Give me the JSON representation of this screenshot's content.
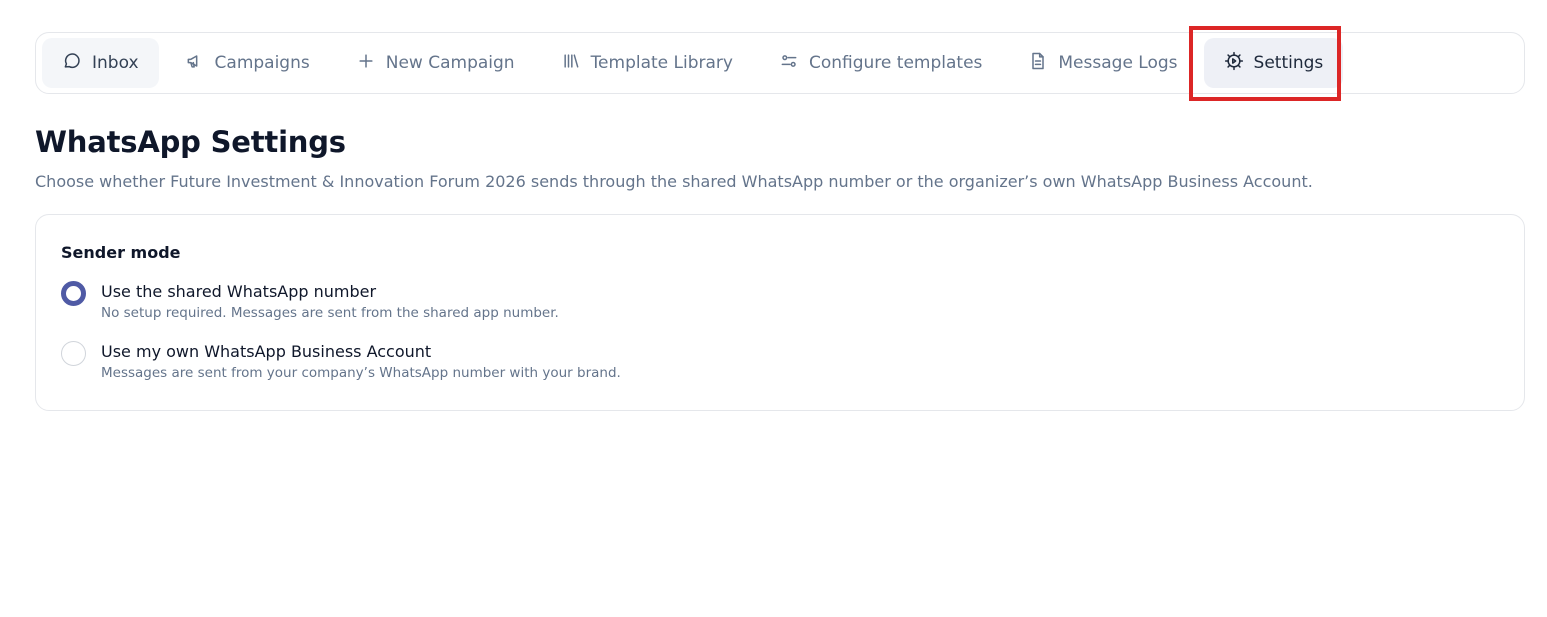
{
  "tabs": [
    {
      "id": "inbox",
      "label": "Inbox",
      "icon": "chat-bubble-icon"
    },
    {
      "id": "campaigns",
      "label": "Campaigns",
      "icon": "megaphone-icon"
    },
    {
      "id": "new-campaign",
      "label": "New Campaign",
      "icon": "plus-icon"
    },
    {
      "id": "template-library",
      "label": "Template Library",
      "icon": "library-icon"
    },
    {
      "id": "configure-templates",
      "label": "Configure templates",
      "icon": "sliders-icon"
    },
    {
      "id": "message-logs",
      "label": "Message Logs",
      "icon": "document-icon"
    },
    {
      "id": "settings",
      "label": "Settings",
      "icon": "gear-icon",
      "active": true
    }
  ],
  "page": {
    "title": "WhatsApp Settings",
    "subtitle": "Choose whether Future Investment & Innovation Forum 2026 sends through the shared WhatsApp number or the organizer’s own WhatsApp Business Account."
  },
  "sender_mode": {
    "label": "Sender mode",
    "options": [
      {
        "title": "Use the shared WhatsApp number",
        "desc": "No setup required. Messages are sent from the shared app number.",
        "checked": true
      },
      {
        "title": "Use my own WhatsApp Business Account",
        "desc": "Messages are sent from your company’s WhatsApp number with your brand.",
        "checked": false
      }
    ]
  },
  "colors": {
    "accent": "#4f5aa5",
    "highlight": "#dc2626"
  }
}
